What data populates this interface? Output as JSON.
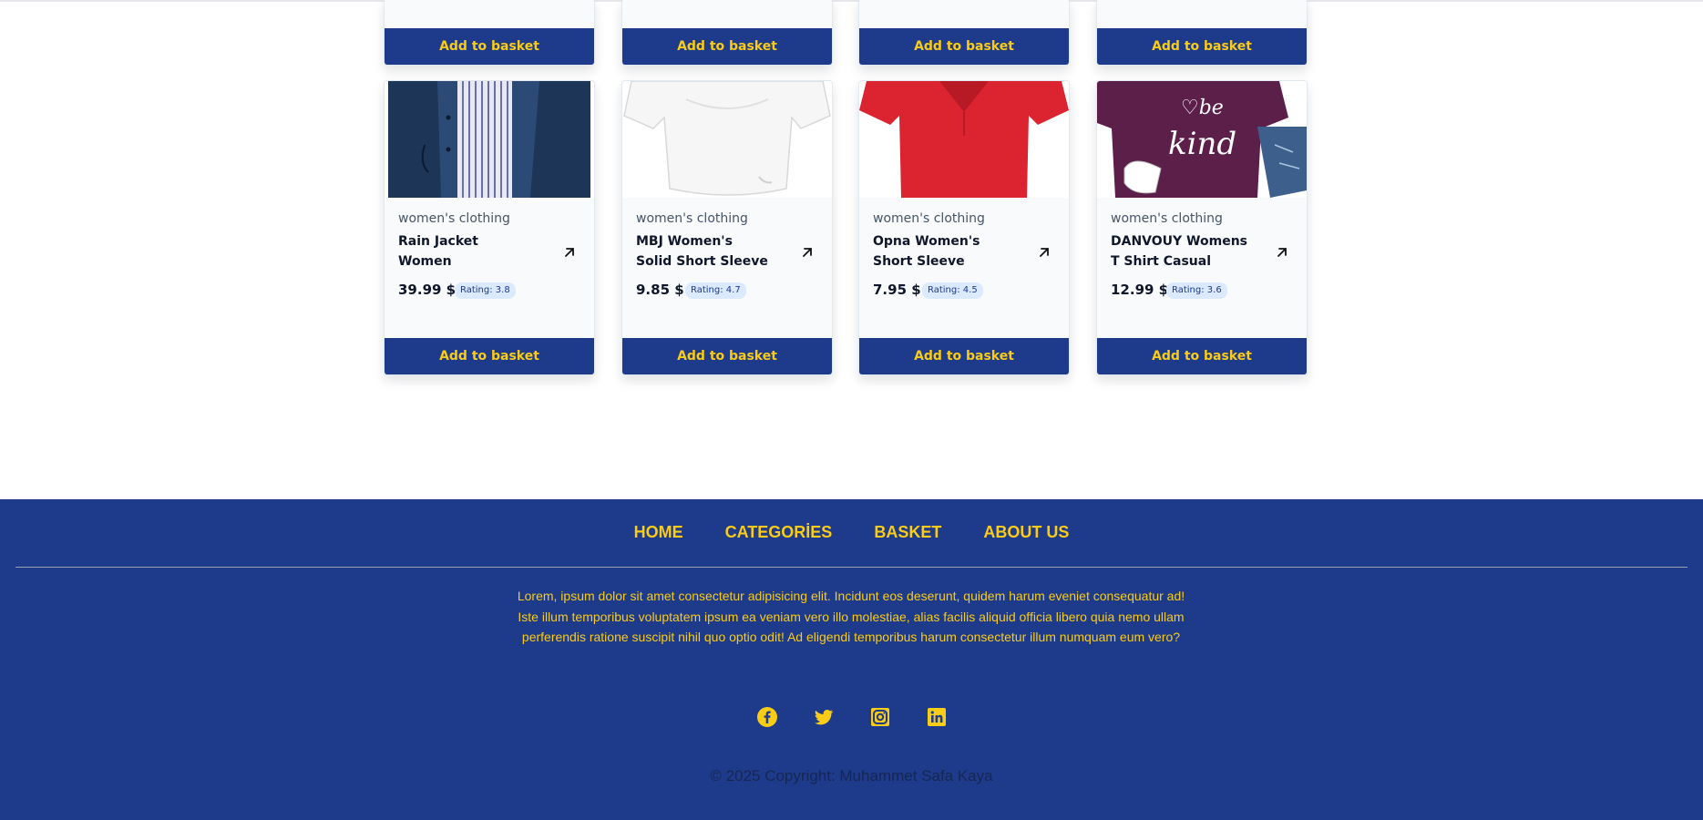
{
  "products_top": [
    {
      "button_label": "Add to basket"
    },
    {
      "button_label": "Add to basket"
    },
    {
      "button_label": "Add to basket"
    },
    {
      "button_label": "Add to basket"
    }
  ],
  "products": [
    {
      "category": "women's clothing",
      "title": "Rain Jacket Women Windbreaker Stripe...",
      "price": "39.99 $",
      "rating": "Rating: 3.8",
      "button_label": "Add to basket"
    },
    {
      "category": "women's clothing",
      "title": "MBJ Women's Solid Short Sleeve Boat ...",
      "price": "9.85 $",
      "rating": "Rating: 4.7",
      "button_label": "Add to basket"
    },
    {
      "category": "women's clothing",
      "title": "Opna Women's Short Sleeve Moisture",
      "price": "7.95 $",
      "rating": "Rating: 4.5",
      "button_label": "Add to basket"
    },
    {
      "category": "women's clothing",
      "title": "DANVOUY Womens T Shirt Casual Cotton...",
      "price": "12.99 $",
      "rating": "Rating: 3.6",
      "button_label": "Add to basket"
    }
  ],
  "footer": {
    "nav": [
      "HOME",
      "CATEGORİES",
      "BASKET",
      "ABOUT US"
    ],
    "text": "Lorem, ipsum dolor sit amet consectetur adipisicing elit. Incidunt eos deserunt, quidem harum eveniet consequatur ad! Iste illum temporibus voluptatem ipsum ea veniam vero illo molestiae, alias facilis aliquid officia libero quia nemo ullam perferendis ratione suscipit nihil quo optio odit! Ad eligendi temporibus harum consectetur illum numquam eum vero?",
    "social_icons": [
      "facebook-icon",
      "twitter-icon",
      "instagram-icon",
      "linkedin-icon"
    ],
    "copyright": "© 2025 Copyright: Muhammet Safa Kaya"
  },
  "colors": {
    "primary": "#1e3a8a",
    "accent": "#facc15",
    "card_bg": "#f8fafc",
    "badge_bg": "#dbeafe"
  }
}
